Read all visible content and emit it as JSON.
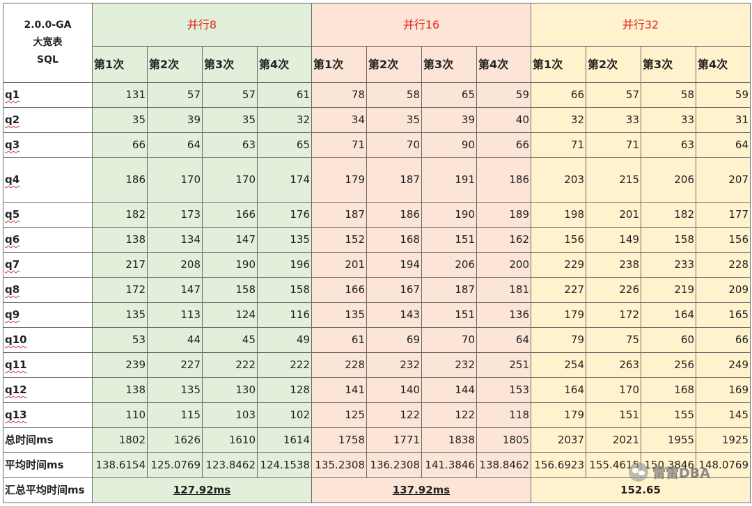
{
  "corner": {
    "line1": "2.0.0-GA",
    "line2": "大宽表",
    "line3": "SQL"
  },
  "groups": [
    "并行8",
    "并行16",
    "并行32"
  ],
  "runs": [
    "第1次",
    "第2次",
    "第3次",
    "第4次"
  ],
  "rows": [
    {
      "label": "q1",
      "values": [
        "131",
        "57",
        "57",
        "61",
        "78",
        "58",
        "65",
        "59",
        "66",
        "57",
        "58",
        "59"
      ]
    },
    {
      "label": "q2",
      "values": [
        "35",
        "39",
        "35",
        "32",
        "34",
        "35",
        "39",
        "40",
        "32",
        "33",
        "33",
        "31"
      ]
    },
    {
      "label": "q3",
      "values": [
        "66",
        "64",
        "63",
        "65",
        "71",
        "70",
        "90",
        "66",
        "71",
        "71",
        "63",
        "64"
      ]
    },
    {
      "label": "q4",
      "values": [
        "186",
        "170",
        "170",
        "174",
        "179",
        "187",
        "191",
        "186",
        "203",
        "215",
        "206",
        "207"
      ]
    },
    {
      "label": "q5",
      "values": [
        "182",
        "173",
        "166",
        "176",
        "187",
        "186",
        "190",
        "189",
        "198",
        "201",
        "182",
        "177"
      ]
    },
    {
      "label": "q6",
      "values": [
        "138",
        "134",
        "147",
        "135",
        "152",
        "168",
        "151",
        "162",
        "156",
        "149",
        "158",
        "156"
      ]
    },
    {
      "label": "q7",
      "values": [
        "217",
        "208",
        "190",
        "196",
        "201",
        "194",
        "206",
        "200",
        "229",
        "238",
        "233",
        "228"
      ]
    },
    {
      "label": "q8",
      "values": [
        "172",
        "147",
        "158",
        "158",
        "166",
        "167",
        "187",
        "181",
        "227",
        "226",
        "219",
        "209"
      ]
    },
    {
      "label": "q9",
      "values": [
        "135",
        "113",
        "124",
        "116",
        "135",
        "143",
        "151",
        "136",
        "179",
        "172",
        "164",
        "165"
      ]
    },
    {
      "label": "q10",
      "values": [
        "53",
        "44",
        "45",
        "49",
        "61",
        "69",
        "70",
        "64",
        "79",
        "75",
        "60",
        "66"
      ]
    },
    {
      "label": "q11",
      "values": [
        "239",
        "227",
        "222",
        "222",
        "228",
        "232",
        "232",
        "251",
        "254",
        "263",
        "256",
        "249"
      ]
    },
    {
      "label": "q12",
      "values": [
        "138",
        "135",
        "130",
        "128",
        "141",
        "140",
        "144",
        "153",
        "164",
        "170",
        "168",
        "169"
      ]
    },
    {
      "label": "q13",
      "values": [
        "110",
        "115",
        "103",
        "102",
        "125",
        "122",
        "122",
        "118",
        "179",
        "151",
        "155",
        "145"
      ]
    },
    {
      "label": "总时间ms",
      "values": [
        "1802",
        "1626",
        "1610",
        "1614",
        "1758",
        "1771",
        "1838",
        "1805",
        "2037",
        "2021",
        "1955",
        "1925"
      ]
    },
    {
      "label": "平均时间ms",
      "values": [
        "138.6154",
        "125.0769",
        "123.8462",
        "124.1538",
        "135.2308",
        "136.2308",
        "141.3846",
        "138.8462",
        "156.6923",
        "155.4615",
        "150.3846",
        "148.0769"
      ]
    }
  ],
  "summary": {
    "label": "汇总平均时间ms",
    "values": [
      "127.92ms",
      "137.92ms",
      "152.65"
    ]
  },
  "watermark": {
    "text": "雷雷DBA"
  },
  "colors": {
    "group8": "#e2efda",
    "group16": "#fce4d6",
    "group32": "#fff2cc",
    "header_text": "#e0261f"
  }
}
